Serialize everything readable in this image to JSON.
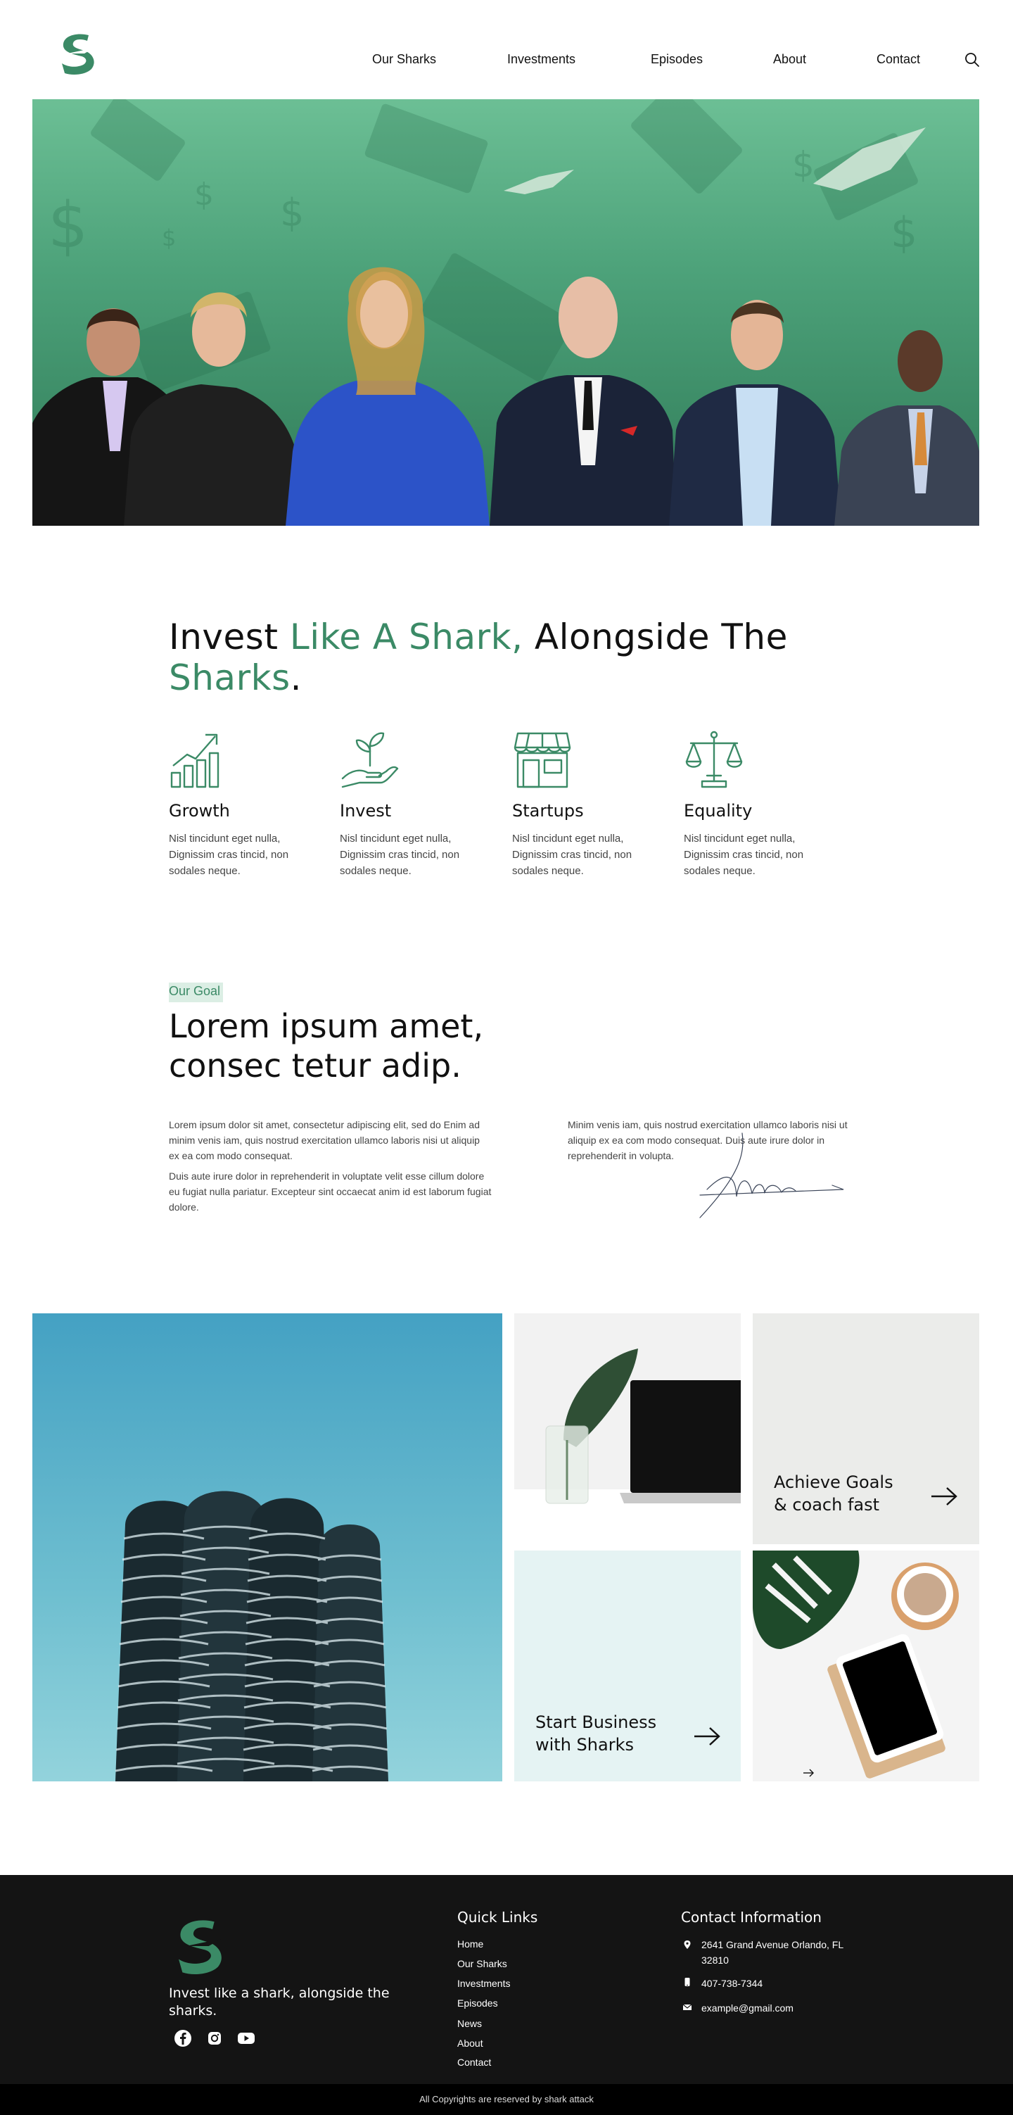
{
  "header": {
    "nav": [
      "Our Sharks",
      "Investments",
      "Episodes",
      "About",
      "Contact"
    ],
    "search_icon": "search-icon",
    "logo_icon": "shark-s-logo"
  },
  "colors": {
    "accent": "#3b8a66",
    "hero_green": "#4da27a",
    "footer_bg": "#141414",
    "tile_gray": "#ebecea",
    "tile_mint": "#e5f3f3"
  },
  "headline": {
    "part1": "Invest ",
    "accent1": "Like A Shark,",
    "part2": " Alongside The ",
    "accent2": "Sharks",
    "end": "."
  },
  "features": [
    {
      "icon": "growth-chart-icon",
      "title": "Growth",
      "text": "Nisl tincidunt eget nulla, Dignissim cras tincid, non sodales neque."
    },
    {
      "icon": "plant-hand-icon",
      "title": "Invest",
      "text": "Nisl tincidunt eget nulla, Dignissim cras tincid, non sodales neque."
    },
    {
      "icon": "storefront-icon",
      "title": "Startups",
      "text": "Nisl tincidunt eget nulla, Dignissim cras tincid, non sodales neque."
    },
    {
      "icon": "scales-icon",
      "title": "Equality",
      "text": "Nisl tincidunt eget nulla, Dignissim cras tincid, non sodales neque."
    }
  ],
  "goal": {
    "tag": "Our Goal",
    "title_line1": "Lorem ipsum amet,",
    "title_line2": "consec tetur adip.",
    "p1": "Lorem ipsum dolor sit amet, consectetur adipiscing elit, sed do Enim ad minim venis iam, quis nostrud exercitation ullamco laboris nisi ut aliquip ex ea com modo consequat.",
    "p2": "Duis aute irure dolor in reprehenderit in voluptate velit esse cillum dolore eu fugiat nulla pariatur. Excepteur sint occaecat anim id est laborum fugiat dolore.",
    "p3": "Minim venis iam, quis nostrud exercitation ullamco laboris nisi ut aliquip ex ea com modo consequat. Duis aute irure dolor in reprehenderit in volupta."
  },
  "gallery": {
    "tile1_line1": "Achieve Goals",
    "tile1_line2": "& coach fast",
    "tile2_line1": "Start Business",
    "tile2_line2": "with Sharks"
  },
  "footer": {
    "tagline": "Invest like a shark, alongside the sharks.",
    "social": [
      "facebook-icon",
      "instagram-icon",
      "youtube-icon"
    ],
    "quick_links_heading": "Quick Links",
    "links": [
      "Home",
      "Our Sharks",
      "Investments",
      "Episodes",
      "News",
      "About",
      "Contact"
    ],
    "contact_heading": "Contact Information",
    "address": "2641 Grand Avenue Orlando, FL 32810",
    "phone": "407-738-7344",
    "email": "example@gmail.com",
    "copyright": "All Copyrights are reserved by shark attack"
  }
}
